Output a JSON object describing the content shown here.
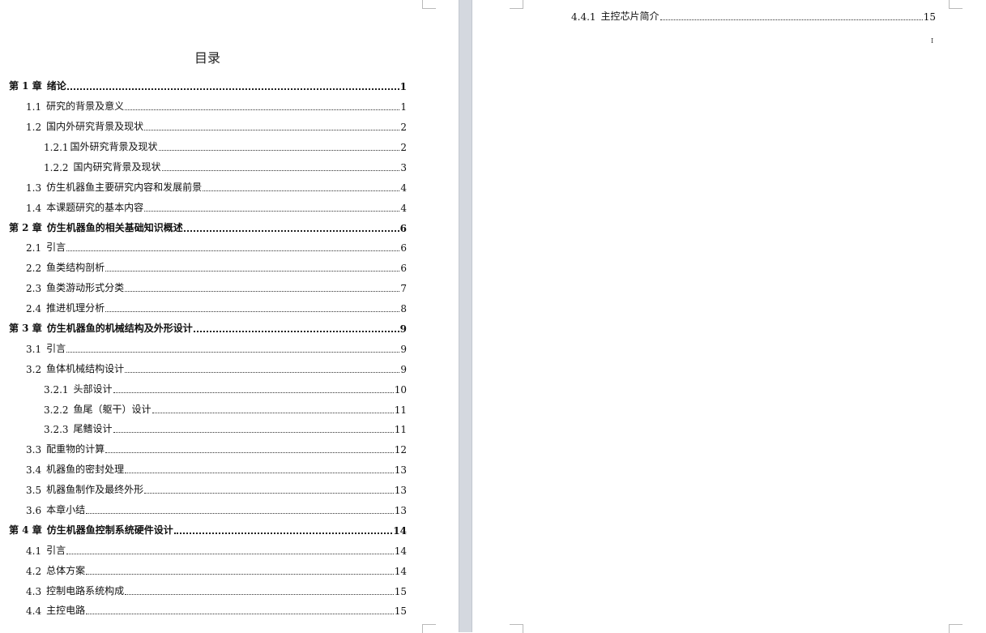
{
  "left_page": {
    "title": "目录",
    "entries": [
      {
        "num": "第 1 章",
        "text": "绪论",
        "page": "1"
      },
      {
        "num": "1.1",
        "text": "研究的背景及意义",
        "page": "1"
      },
      {
        "num": "1.2",
        "text": "国内外研究背景及现状",
        "page": "2"
      },
      {
        "num": "1.2.1",
        "text": "国外研究背景及现状",
        "page": "2"
      },
      {
        "num": "1.2.2",
        "text": "国内研究背景及现状",
        "page": "3"
      },
      {
        "num": "1.3",
        "text": "仿生机器鱼主要研究内容和发展前景",
        "page": "4"
      },
      {
        "num": "1.4",
        "text": "本课题研究的基本内容",
        "page": "4"
      },
      {
        "num": "第 2 章",
        "text": "仿生机器鱼的相关基础知识概述",
        "page": "6"
      },
      {
        "num": "2.1",
        "text": "引言",
        "page": "6"
      },
      {
        "num": "2.2",
        "text": "鱼类结构剖析",
        "page": "6"
      },
      {
        "num": "2.3",
        "text": "鱼类游动形式分类",
        "page": "7"
      },
      {
        "num": "2.4",
        "text": "推进机理分析",
        "page": "8"
      },
      {
        "num": "第 3 章",
        "text": "仿生机器鱼的机械结构及外形设计",
        "page": "9"
      },
      {
        "num": "3.1",
        "text": "引言",
        "page": "9"
      },
      {
        "num": "3.2",
        "text": "鱼体机械结构设计",
        "page": "9"
      },
      {
        "num": "3.2.1",
        "text": "头部设计",
        "page": "10"
      },
      {
        "num": "3.2.2",
        "text": "鱼尾（躯干）设计",
        "page": "11"
      },
      {
        "num": "3.2.3",
        "text": "尾鳍设计",
        "page": "11"
      },
      {
        "num": "3.3",
        "text": "配重物的计算",
        "page": "12"
      },
      {
        "num": "3.4",
        "text": "机器鱼的密封处理",
        "page": "13"
      },
      {
        "num": "3.5",
        "text": "机器鱼制作及最终外形",
        "page": "13"
      },
      {
        "num": "3.6",
        "text": "本章小结",
        "page": "13"
      },
      {
        "num": "第 4 章",
        "text": "仿生机器鱼控制系统硬件设计",
        "page": "14"
      },
      {
        "num": "4.1",
        "text": "引言",
        "page": "14"
      },
      {
        "num": "4.2",
        "text": "总体方案",
        "page": "14"
      },
      {
        "num": "4.3",
        "text": "控制电路系统构成",
        "page": "15"
      },
      {
        "num": "4.4",
        "text": "主控电路",
        "page": "15"
      }
    ]
  },
  "right_page": {
    "entry": {
      "num": "4.4.1",
      "text": "主控芯片简介",
      "page": "15"
    },
    "page_number": "I"
  }
}
